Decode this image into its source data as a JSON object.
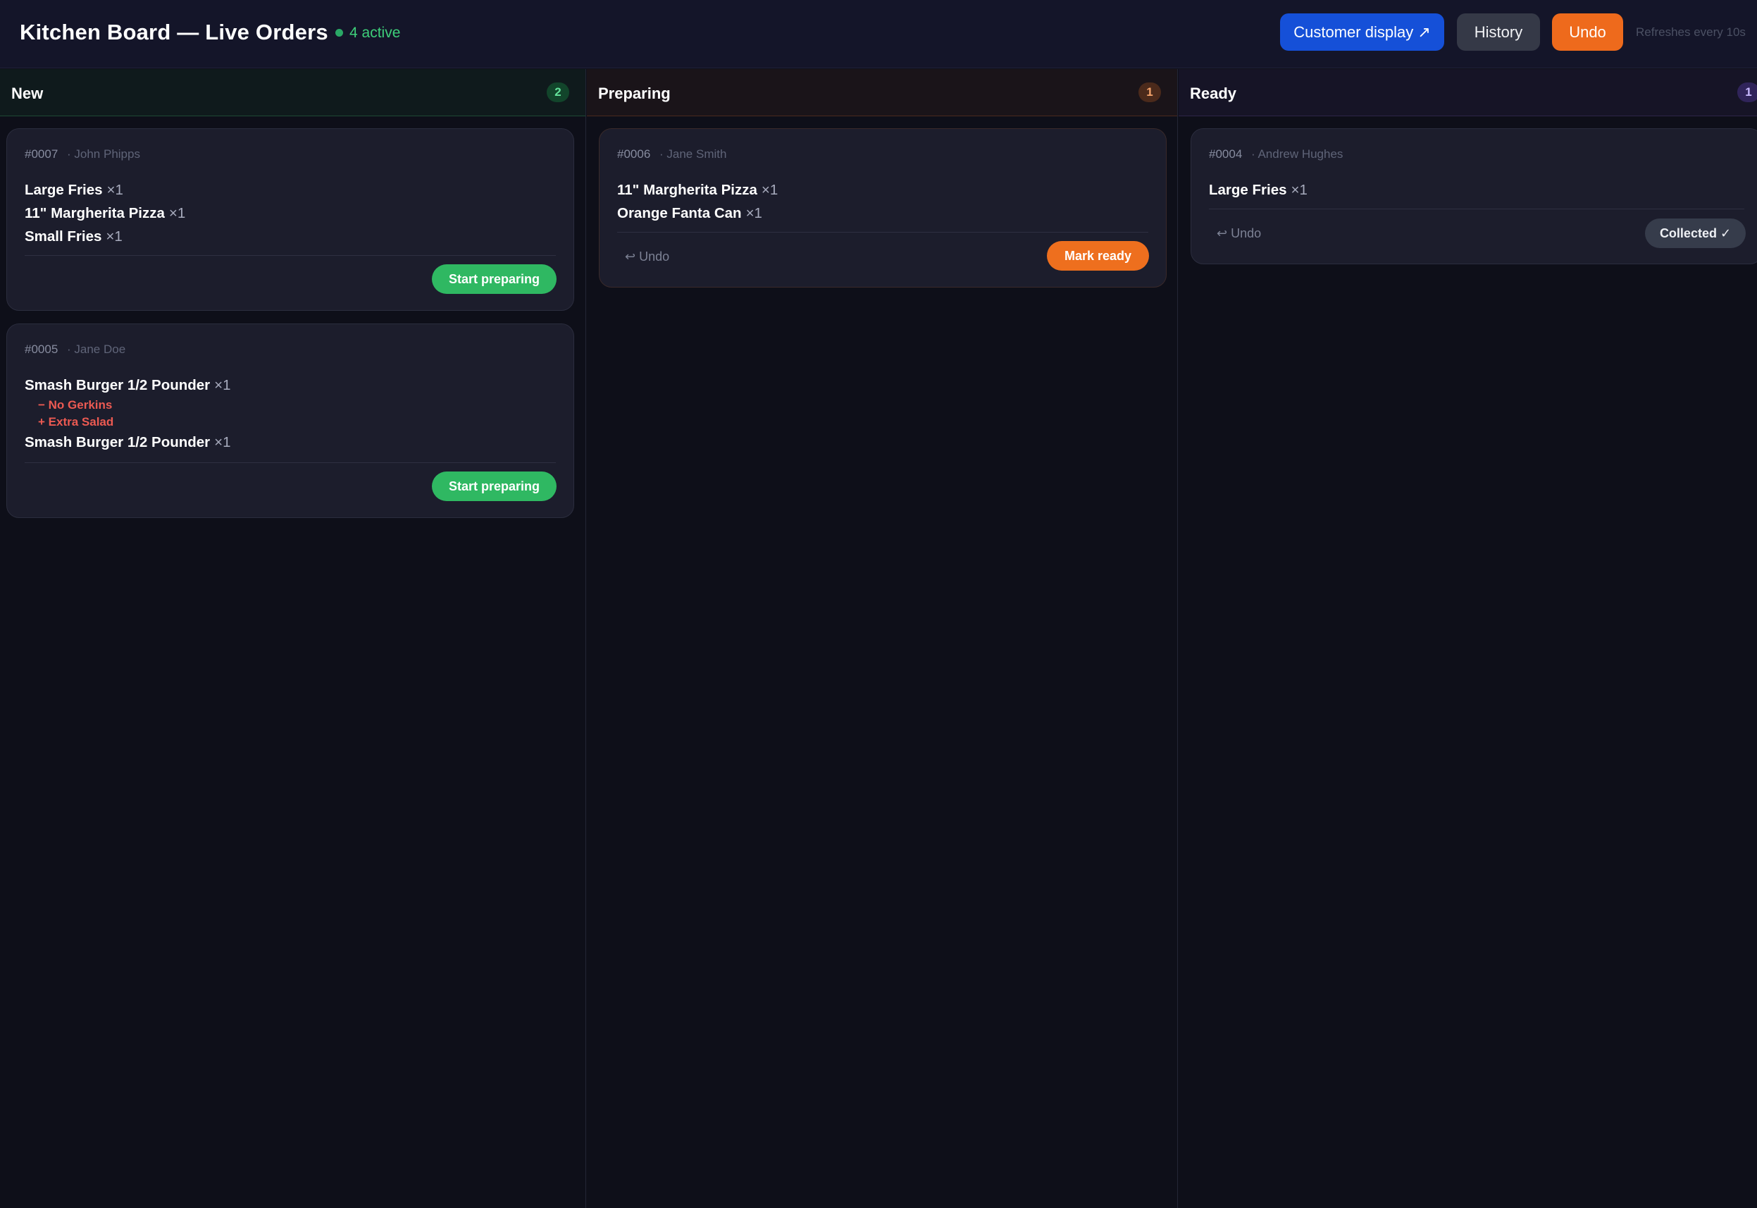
{
  "header": {
    "title": "Kitchen Board — Live Orders",
    "active_count": "4 active",
    "customer_display_label": "Customer display ↗",
    "history_label": "History",
    "undo_label": "Undo",
    "refresh_note": "Refreshes every 10s"
  },
  "colors": {
    "new_accent": "#2fb862",
    "preparing_accent": "#ee6f1e",
    "ready_accent": "#7b61ff",
    "customer_display_button": "#1550d8",
    "undo_button": "#ee6a1c",
    "modifier_text": "#ec5a52"
  },
  "columns": [
    {
      "title": "New",
      "count": "2",
      "orders": [
        {
          "number": "#0007",
          "customer": "· John Phipps",
          "items": [
            {
              "name": "Large Fries",
              "qty": "×1"
            },
            {
              "name": "11\" Margherita Pizza",
              "qty": "×1"
            },
            {
              "name": "Small Fries",
              "qty": "×1"
            }
          ],
          "action_label": "Start preparing"
        },
        {
          "number": "#0005",
          "customer": "· Jane Doe",
          "items": [
            {
              "name": "Smash Burger 1/2 Pounder",
              "qty": "×1",
              "modifiers": [
                "− No Gerkins",
                "+ Extra Salad"
              ]
            },
            {
              "name": "Smash Burger 1/2 Pounder",
              "qty": "×1"
            }
          ],
          "action_label": "Start preparing"
        }
      ]
    },
    {
      "title": "Preparing",
      "count": "1",
      "orders": [
        {
          "number": "#0006",
          "customer": "· Jane Smith",
          "items": [
            {
              "name": "11\" Margherita Pizza",
              "qty": "×1"
            },
            {
              "name": "Orange Fanta Can",
              "qty": "×1"
            }
          ],
          "undo_label": "↩ Undo",
          "action_label": "Mark ready"
        }
      ]
    },
    {
      "title": "Ready",
      "count": "1",
      "orders": [
        {
          "number": "#0004",
          "customer": "· Andrew Hughes",
          "items": [
            {
              "name": "Large Fries",
              "qty": "×1"
            }
          ],
          "undo_label": "↩ Undo",
          "action_label": "Collected ✓"
        }
      ]
    }
  ]
}
